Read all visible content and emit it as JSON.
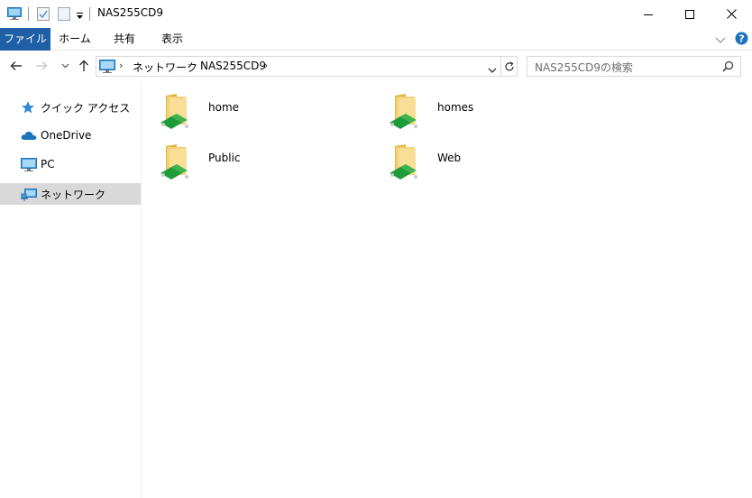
{
  "window": {
    "title": "NAS255CD9",
    "icons": [
      "computer-icon",
      "properties-check-icon",
      "new-folder-icon",
      "customize-qat-icon"
    ],
    "controls": [
      "minimize-icon",
      "maximize-icon",
      "close-icon"
    ]
  },
  "ribbon": {
    "tabs": [
      {
        "label": "ファイル"
      },
      {
        "label": "ホーム"
      },
      {
        "label": "共有"
      },
      {
        "label": "表示"
      }
    ],
    "right_icons": [
      "expand-ribbon-icon",
      "help-icon"
    ]
  },
  "address": {
    "crumbs": [
      "ネットワーク",
      "NAS255CD9"
    ],
    "search_placeholder": "NAS255CD9の検索"
  },
  "sidebar": {
    "items": [
      {
        "label": "クイック アクセス",
        "icon": "quick-access-star-icon"
      },
      {
        "label": "OneDrive",
        "icon": "onedrive-cloud-icon"
      },
      {
        "label": "PC",
        "icon": "pc-monitor-icon"
      },
      {
        "label": "ネットワーク",
        "icon": "network-icon",
        "selected": true
      }
    ]
  },
  "content": {
    "folders": [
      {
        "name": "home"
      },
      {
        "name": "homes"
      },
      {
        "name": "Public"
      },
      {
        "name": "Web"
      }
    ]
  }
}
